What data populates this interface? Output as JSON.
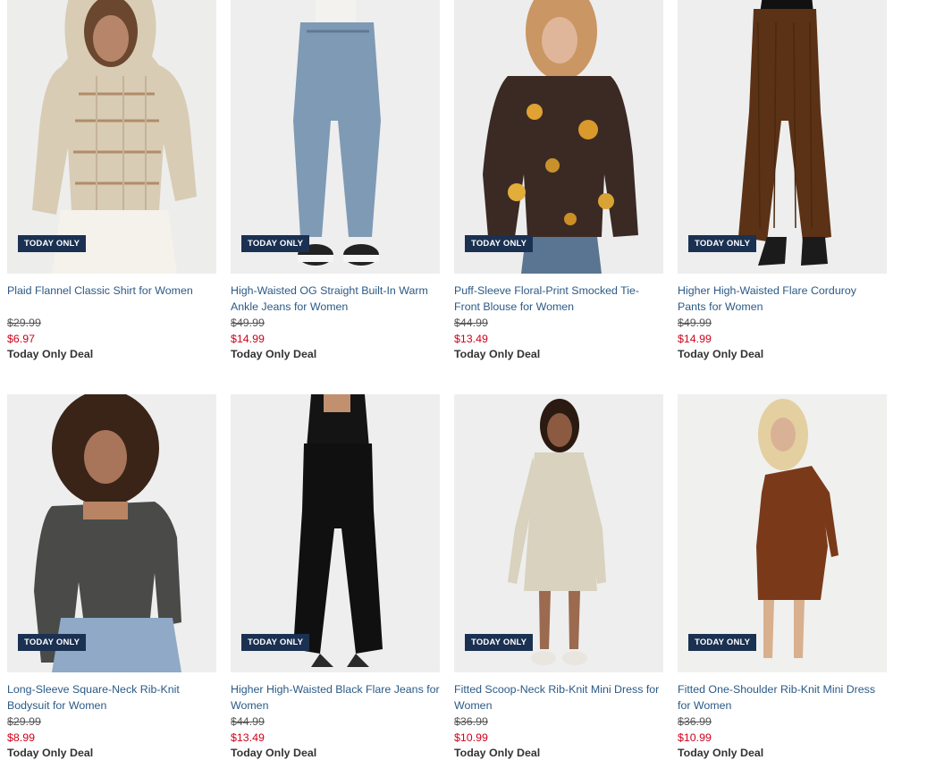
{
  "badge_label": "TODAY ONLY",
  "deal_label": "Today Only Deal",
  "products": [
    {
      "name": "Plaid Flannel Classic Shirt for Women",
      "original_price": "$29.99",
      "sale_price": "$6.97"
    },
    {
      "name": "High-Waisted OG Straight Built-In Warm Ankle Jeans for Women",
      "original_price": "$49.99",
      "sale_price": "$14.99"
    },
    {
      "name": "Puff-Sleeve Floral-Print Smocked Tie-Front Blouse for Women",
      "original_price": "$44.99",
      "sale_price": "$13.49"
    },
    {
      "name": "Higher High-Waisted Flare Corduroy Pants for Women",
      "original_price": "$49.99",
      "sale_price": "$14.99"
    },
    {
      "name": "Long-Sleeve Square-Neck Rib-Knit Bodysuit for Women",
      "original_price": "$29.99",
      "sale_price": "$8.99"
    },
    {
      "name": "Higher High-Waisted Black Flare Jeans for Women",
      "original_price": "$44.99",
      "sale_price": "$13.49"
    },
    {
      "name": "Fitted Scoop-Neck Rib-Knit Mini Dress for Women",
      "original_price": "$36.99",
      "sale_price": "$10.99"
    },
    {
      "name": "Fitted One-Shoulder Rib-Knit Mini Dress for Women",
      "original_price": "$36.99",
      "sale_price": "$10.99"
    }
  ],
  "colors": {
    "badge_bg": "#1b3152",
    "name_link": "#2b5a86",
    "sale_price": "#d0021b"
  }
}
